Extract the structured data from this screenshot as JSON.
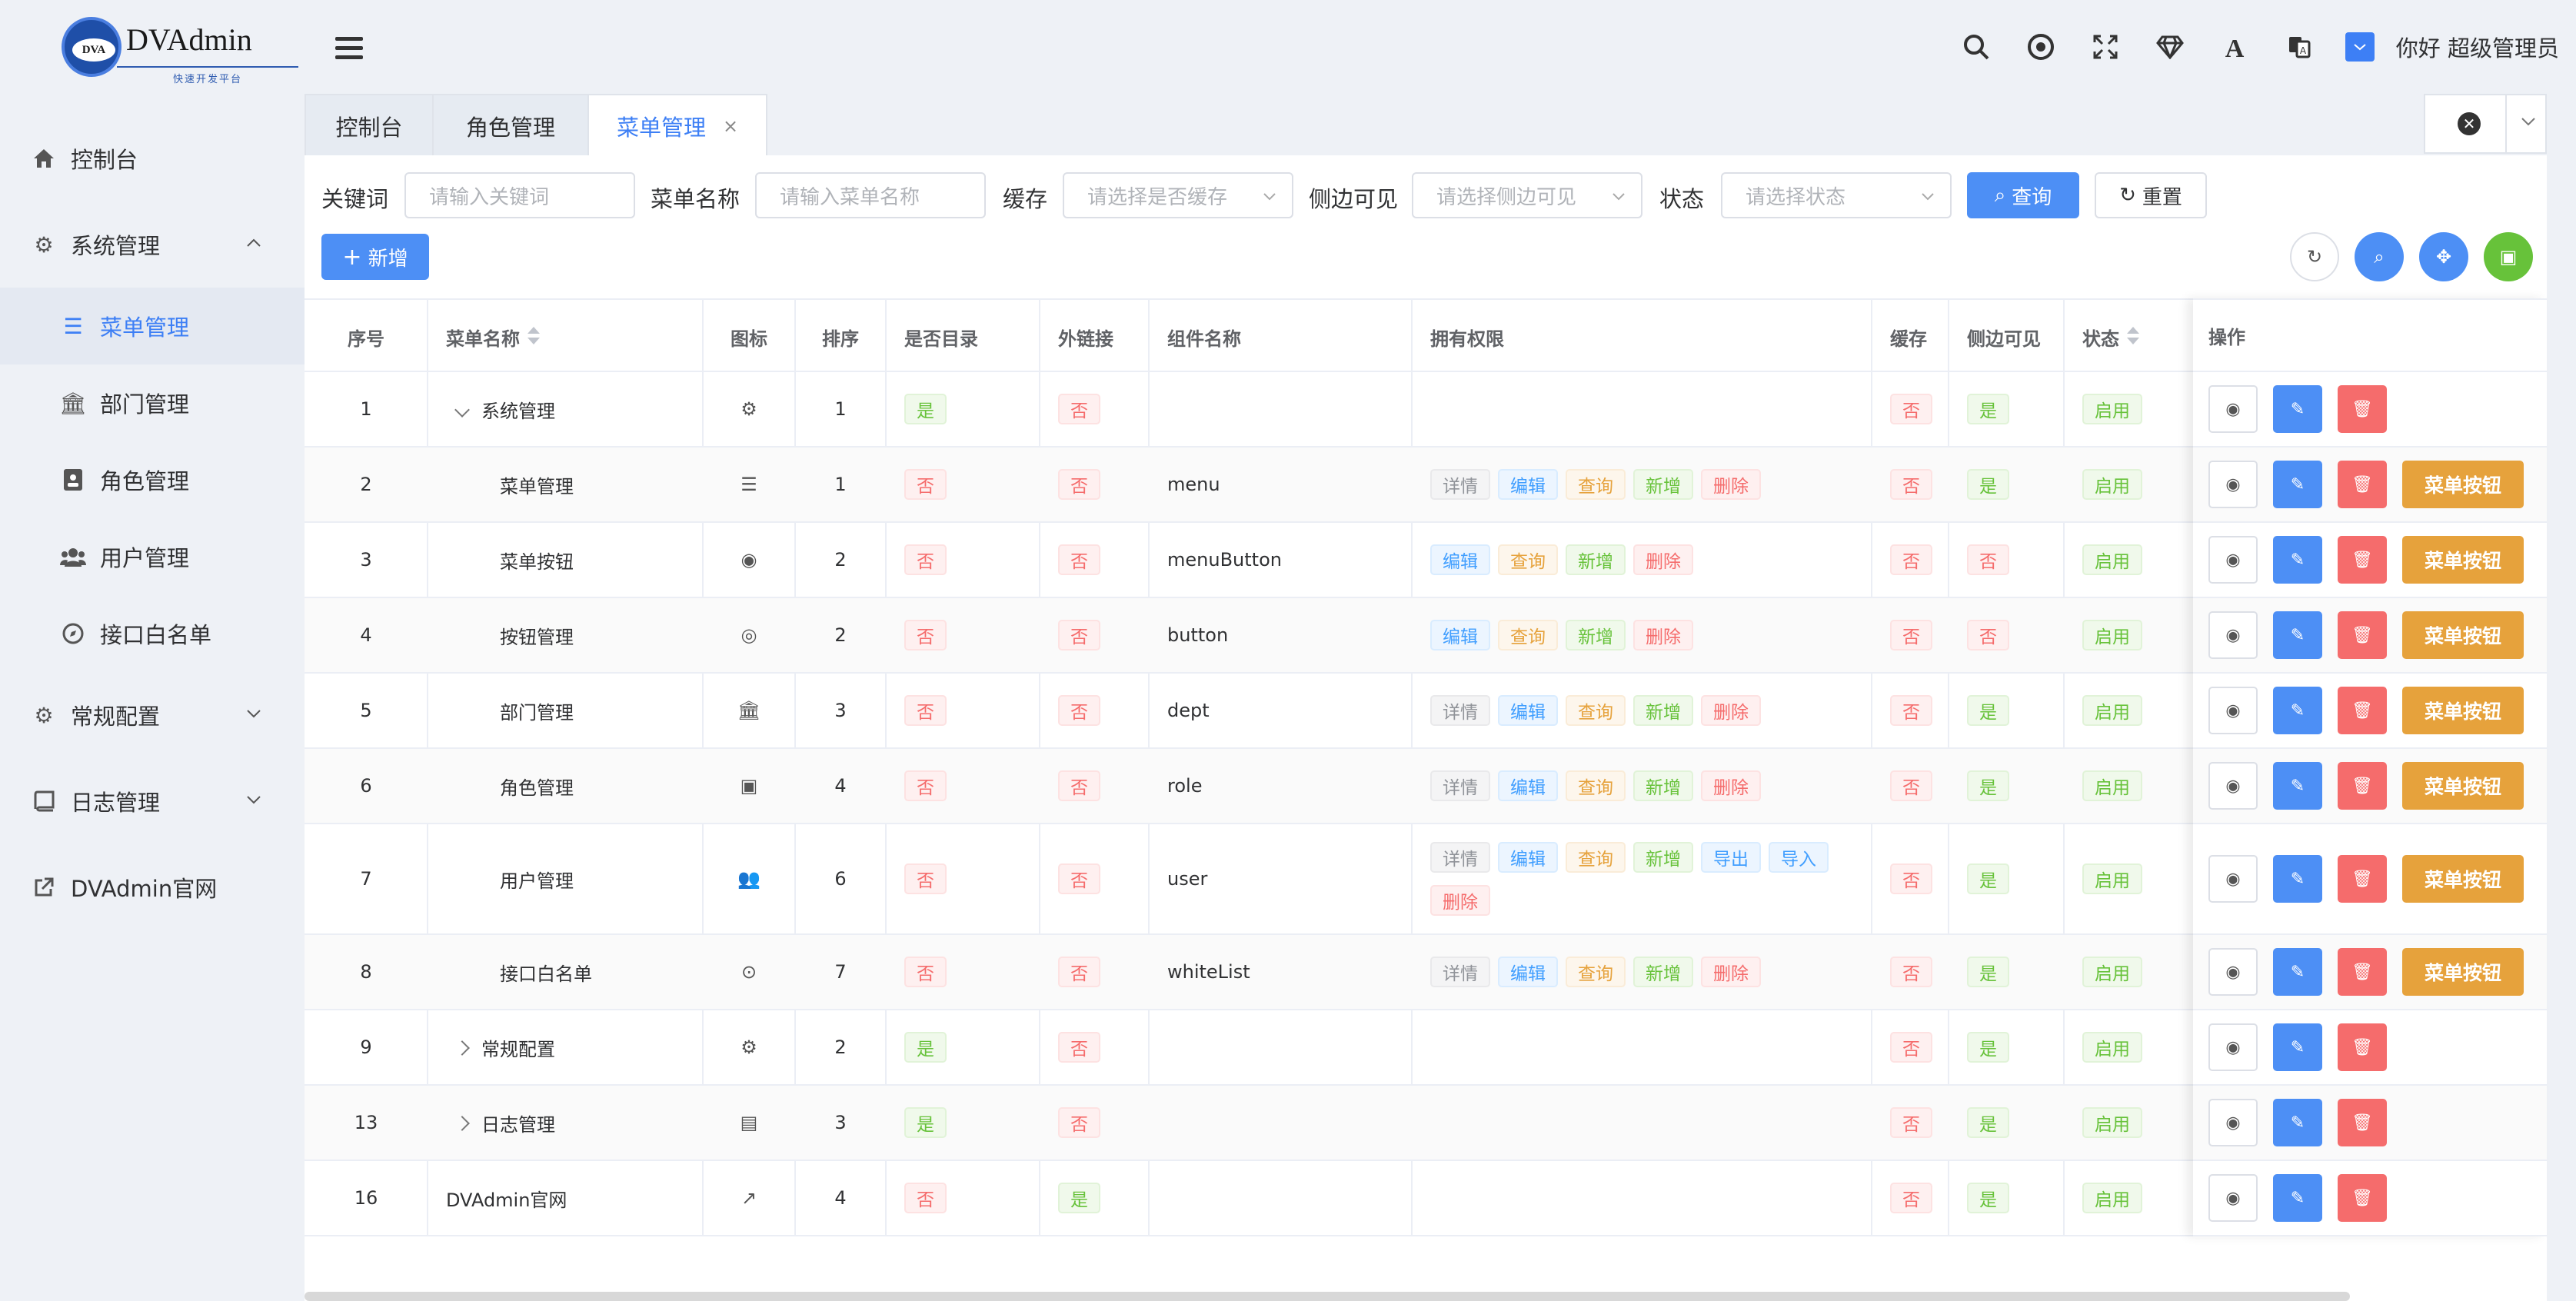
{
  "brand": {
    "logo_mark": "DVA",
    "title": "DVAdmin",
    "subtitle": "快速开发平台"
  },
  "sidebar": {
    "items": [
      {
        "label": "控制台",
        "icon": "home-icon"
      },
      {
        "label": "系统管理",
        "icon": "gear-icon",
        "expanded": true
      },
      {
        "label": "菜单管理",
        "icon": "list-icon",
        "active": true
      },
      {
        "label": "部门管理",
        "icon": "bank-icon"
      },
      {
        "label": "角色管理",
        "icon": "id-badge-icon"
      },
      {
        "label": "用户管理",
        "icon": "users-icon"
      },
      {
        "label": "接口白名单",
        "icon": "compass-icon"
      },
      {
        "label": "常规配置",
        "icon": "gears-icon"
      },
      {
        "label": "日志管理",
        "icon": "book-icon"
      },
      {
        "label": "DVAdmin官网",
        "icon": "external-link-icon"
      }
    ]
  },
  "header": {
    "greeting": "你好 超级管理员"
  },
  "tabs": [
    {
      "label": "控制台"
    },
    {
      "label": "角色管理"
    },
    {
      "label": "菜单管理",
      "close": "×",
      "active": true
    }
  ],
  "filters": {
    "keyword_label": "关键词",
    "keyword_placeholder": "请输入关键词",
    "menu_name_label": "菜单名称",
    "menu_name_placeholder": "请输入菜单名称",
    "cache_label": "缓存",
    "cache_placeholder": "请选择是否缓存",
    "sidebar_visible_label": "侧边可见",
    "sidebar_visible_placeholder": "请选择侧边可见",
    "status_label": "状态",
    "status_placeholder": "请选择状态",
    "search_button": "查询",
    "reset_button": "重置",
    "add_button": "新增"
  },
  "table": {
    "columns": [
      "序号",
      "菜单名称",
      "图标",
      "排序",
      "是否目录",
      "外链接",
      "组件名称",
      "拥有权限",
      "缓存",
      "侧边可见",
      "状态",
      "操作"
    ],
    "menu_button_label": "菜单按钮",
    "rows": [
      {
        "id": "1",
        "name": "系统管理",
        "tree": "expanded",
        "icon": "gear-icon",
        "sort": "1",
        "is_catalog": "是",
        "is_link": "否",
        "component": "",
        "perms": [],
        "cache": "否",
        "visible": "是",
        "status": "启用",
        "menu_btn": false
      },
      {
        "id": "2",
        "name": "菜单管理",
        "tree": "child",
        "icon": "list-icon",
        "sort": "1",
        "is_catalog": "否",
        "is_link": "否",
        "component": "menu",
        "perms": [
          "详情",
          "编辑",
          "查询",
          "新增",
          "删除"
        ],
        "cache": "否",
        "visible": "是",
        "status": "启用",
        "menu_btn": true
      },
      {
        "id": "3",
        "name": "菜单按钮",
        "tree": "child",
        "icon": "dot-circle-icon",
        "sort": "2",
        "is_catalog": "否",
        "is_link": "否",
        "component": "menuButton",
        "perms": [
          "编辑",
          "查询",
          "新增",
          "删除"
        ],
        "cache": "否",
        "visible": "否",
        "status": "启用",
        "menu_btn": true
      },
      {
        "id": "4",
        "name": "按钮管理",
        "tree": "child",
        "icon": "bullseye-icon",
        "sort": "2",
        "is_catalog": "否",
        "is_link": "否",
        "component": "button",
        "perms": [
          "编辑",
          "查询",
          "新增",
          "删除"
        ],
        "cache": "否",
        "visible": "否",
        "status": "启用",
        "menu_btn": true
      },
      {
        "id": "5",
        "name": "部门管理",
        "tree": "child",
        "icon": "bank-icon",
        "sort": "3",
        "is_catalog": "否",
        "is_link": "否",
        "component": "dept",
        "perms": [
          "详情",
          "编辑",
          "查询",
          "新增",
          "删除"
        ],
        "cache": "否",
        "visible": "是",
        "status": "启用",
        "menu_btn": true
      },
      {
        "id": "6",
        "name": "角色管理",
        "tree": "child",
        "icon": "id-badge-icon",
        "sort": "4",
        "is_catalog": "否",
        "is_link": "否",
        "component": "role",
        "perms": [
          "详情",
          "编辑",
          "查询",
          "新增",
          "删除"
        ],
        "cache": "否",
        "visible": "是",
        "status": "启用",
        "menu_btn": true
      },
      {
        "id": "7",
        "name": "用户管理",
        "tree": "child",
        "icon": "users-icon",
        "sort": "6",
        "is_catalog": "否",
        "is_link": "否",
        "component": "user",
        "perms": [
          "详情",
          "编辑",
          "查询",
          "新增",
          "导出",
          "导入",
          "删除"
        ],
        "cache": "否",
        "visible": "是",
        "status": "启用",
        "menu_btn": true
      },
      {
        "id": "8",
        "name": "接口白名单",
        "tree": "child",
        "icon": "compass-icon",
        "sort": "7",
        "is_catalog": "否",
        "is_link": "否",
        "component": "whiteList",
        "perms": [
          "详情",
          "编辑",
          "查询",
          "新增",
          "删除"
        ],
        "cache": "否",
        "visible": "是",
        "status": "启用",
        "menu_btn": true
      },
      {
        "id": "9",
        "name": "常规配置",
        "tree": "collapsed",
        "icon": "gears-icon",
        "sort": "2",
        "is_catalog": "是",
        "is_link": "否",
        "component": "",
        "perms": [],
        "cache": "否",
        "visible": "是",
        "status": "启用",
        "menu_btn": false
      },
      {
        "id": "13",
        "name": "日志管理",
        "tree": "collapsed",
        "icon": "book-icon",
        "sort": "3",
        "is_catalog": "是",
        "is_link": "否",
        "component": "",
        "perms": [],
        "cache": "否",
        "visible": "是",
        "status": "启用",
        "menu_btn": false
      },
      {
        "id": "16",
        "name": "DVAdmin官网",
        "tree": "none",
        "icon": "external-link-icon",
        "sort": "4",
        "is_catalog": "否",
        "is_link": "是",
        "component": "",
        "perms": [],
        "cache": "否",
        "visible": "是",
        "status": "启用",
        "menu_btn": false
      }
    ]
  },
  "colors": {
    "primary": "#4d8ff5",
    "danger": "#f56c6c",
    "warning": "#e6a23c",
    "success": "#67c23a"
  }
}
